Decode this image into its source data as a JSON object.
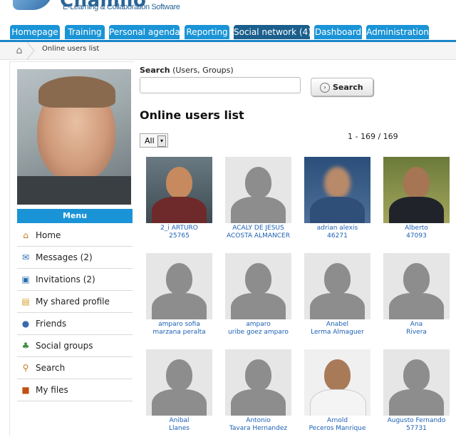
{
  "app": {
    "logo_name": "Chamilo",
    "logo_tagline": "E-Learning & Collaboration Software"
  },
  "tabs": [
    {
      "label": "Homepage"
    },
    {
      "label": "Training"
    },
    {
      "label": "Personal agenda"
    },
    {
      "label": "Reporting"
    },
    {
      "label": "Social network (4)",
      "active": true
    },
    {
      "label": "Dashboard"
    },
    {
      "label": "Administration"
    }
  ],
  "breadcrumb": {
    "current": "Online users list"
  },
  "sidebar": {
    "menu_title": "Menu",
    "items": [
      {
        "label": "Home",
        "icon": "home-icon"
      },
      {
        "label": "Messages (2)",
        "icon": "envelope-icon"
      },
      {
        "label": "Invitations (2)",
        "icon": "invitation-icon"
      },
      {
        "label": "My shared profile",
        "icon": "profile-icon"
      },
      {
        "label": "Friends",
        "icon": "friends-icon"
      },
      {
        "label": "Social groups",
        "icon": "groups-icon"
      },
      {
        "label": "Search",
        "icon": "search-icon"
      },
      {
        "label": "My files",
        "icon": "files-icon"
      }
    ]
  },
  "search": {
    "label_bold": "Search",
    "label_rest": " (Users, Groups)",
    "value": "",
    "button_label": "Search"
  },
  "page_title": "Online users list",
  "filter": {
    "selected": "All"
  },
  "pager": "1 - 169 / 169",
  "users": [
    {
      "line1": "2_i ARTURO",
      "line2": "25765",
      "photo": "real"
    },
    {
      "line1": "ACALY DE JESUS",
      "line2": "ACOSTA ALMANCER",
      "photo": "default"
    },
    {
      "line1": "adrian alexis",
      "line2": "46271",
      "photo": "blur"
    },
    {
      "line1": "Alberto",
      "line2": "47093",
      "photo": "green"
    },
    {
      "line1": "amparo sofia",
      "line2": "marzana peralta",
      "photo": "default"
    },
    {
      "line1": "amparo",
      "line2": "uribe goez amparo",
      "photo": "default"
    },
    {
      "line1": "Anabel",
      "line2": "Lerma Almaguer",
      "photo": "default"
    },
    {
      "line1": "Ana",
      "line2": "Rivera",
      "photo": "default"
    },
    {
      "line1": "Anibal",
      "line2": "Llanes",
      "photo": "default"
    },
    {
      "line1": "Antonio",
      "line2": "Tavara Hernandez",
      "photo": "default"
    },
    {
      "line1": "Arnold",
      "line2": "Peceros Manrique",
      "photo": "light"
    },
    {
      "line1": "Augusto Fernando",
      "line2": "57731",
      "photo": "default"
    }
  ]
}
